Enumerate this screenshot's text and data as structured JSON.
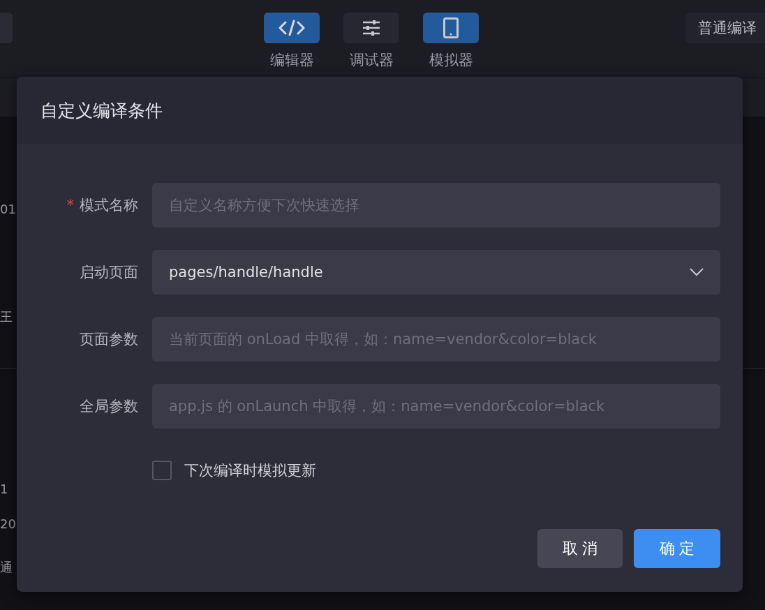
{
  "toolbar": {
    "tools": [
      {
        "label": "编辑器",
        "kind": "code",
        "selected": true
      },
      {
        "label": "调试器",
        "kind": "sliders",
        "selected": false
      },
      {
        "label": "模拟器",
        "kind": "phone",
        "selected": true
      }
    ],
    "compile_mode": "普通编译"
  },
  "background_fragments": [
    "01",
    "王",
    "1",
    "20",
    "通"
  ],
  "dialog": {
    "title": "自定义编译条件",
    "fields": [
      {
        "label": "模式名称",
        "required_mark": "*",
        "kind": "input",
        "placeholder": "自定义名称方便下次快速选择"
      },
      {
        "label": "启动页面",
        "kind": "select",
        "value": "pages/handle/handle"
      },
      {
        "label": "页面参数",
        "kind": "input",
        "placeholder": "当前页面的 onLoad 中取得，如：name=vendor&color=black"
      },
      {
        "label": "全局参数",
        "kind": "input",
        "placeholder": "app.js 的 onLaunch 中取得，如：name=vendor&color=black"
      }
    ],
    "checkbox": {
      "label": "下次编译时模拟更新",
      "checked": false
    },
    "buttons": [
      {
        "label": "取 消",
        "kind": "secondary"
      },
      {
        "label": "确 定",
        "kind": "primary"
      }
    ]
  }
}
